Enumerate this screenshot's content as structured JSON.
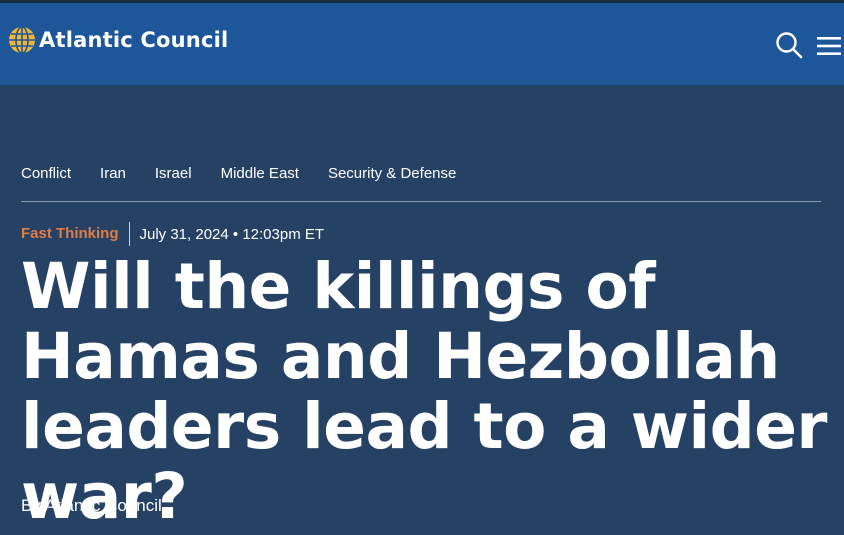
{
  "site": {
    "logo_text": "Atlantic Council",
    "logo_icon": "globe-icon",
    "search_icon": "search-icon",
    "menu_icon": "hamburger-menu-icon"
  },
  "colors": {
    "header_bg": "#1e5799",
    "page_bg": "#254264",
    "accent": "#e07b45",
    "logo_globe": "#f2b53a"
  },
  "topics": [
    "Conflict",
    "Iran",
    "Israel",
    "Middle East",
    "Security & Defense"
  ],
  "article": {
    "series": "Fast Thinking",
    "date": "July 31, 2024 • 12:03pm ET",
    "headline": "Will the killings of Hamas and Hezbollah leaders lead to a wider war?",
    "byline_prefix": "By ",
    "author": "Atlantic Council"
  }
}
